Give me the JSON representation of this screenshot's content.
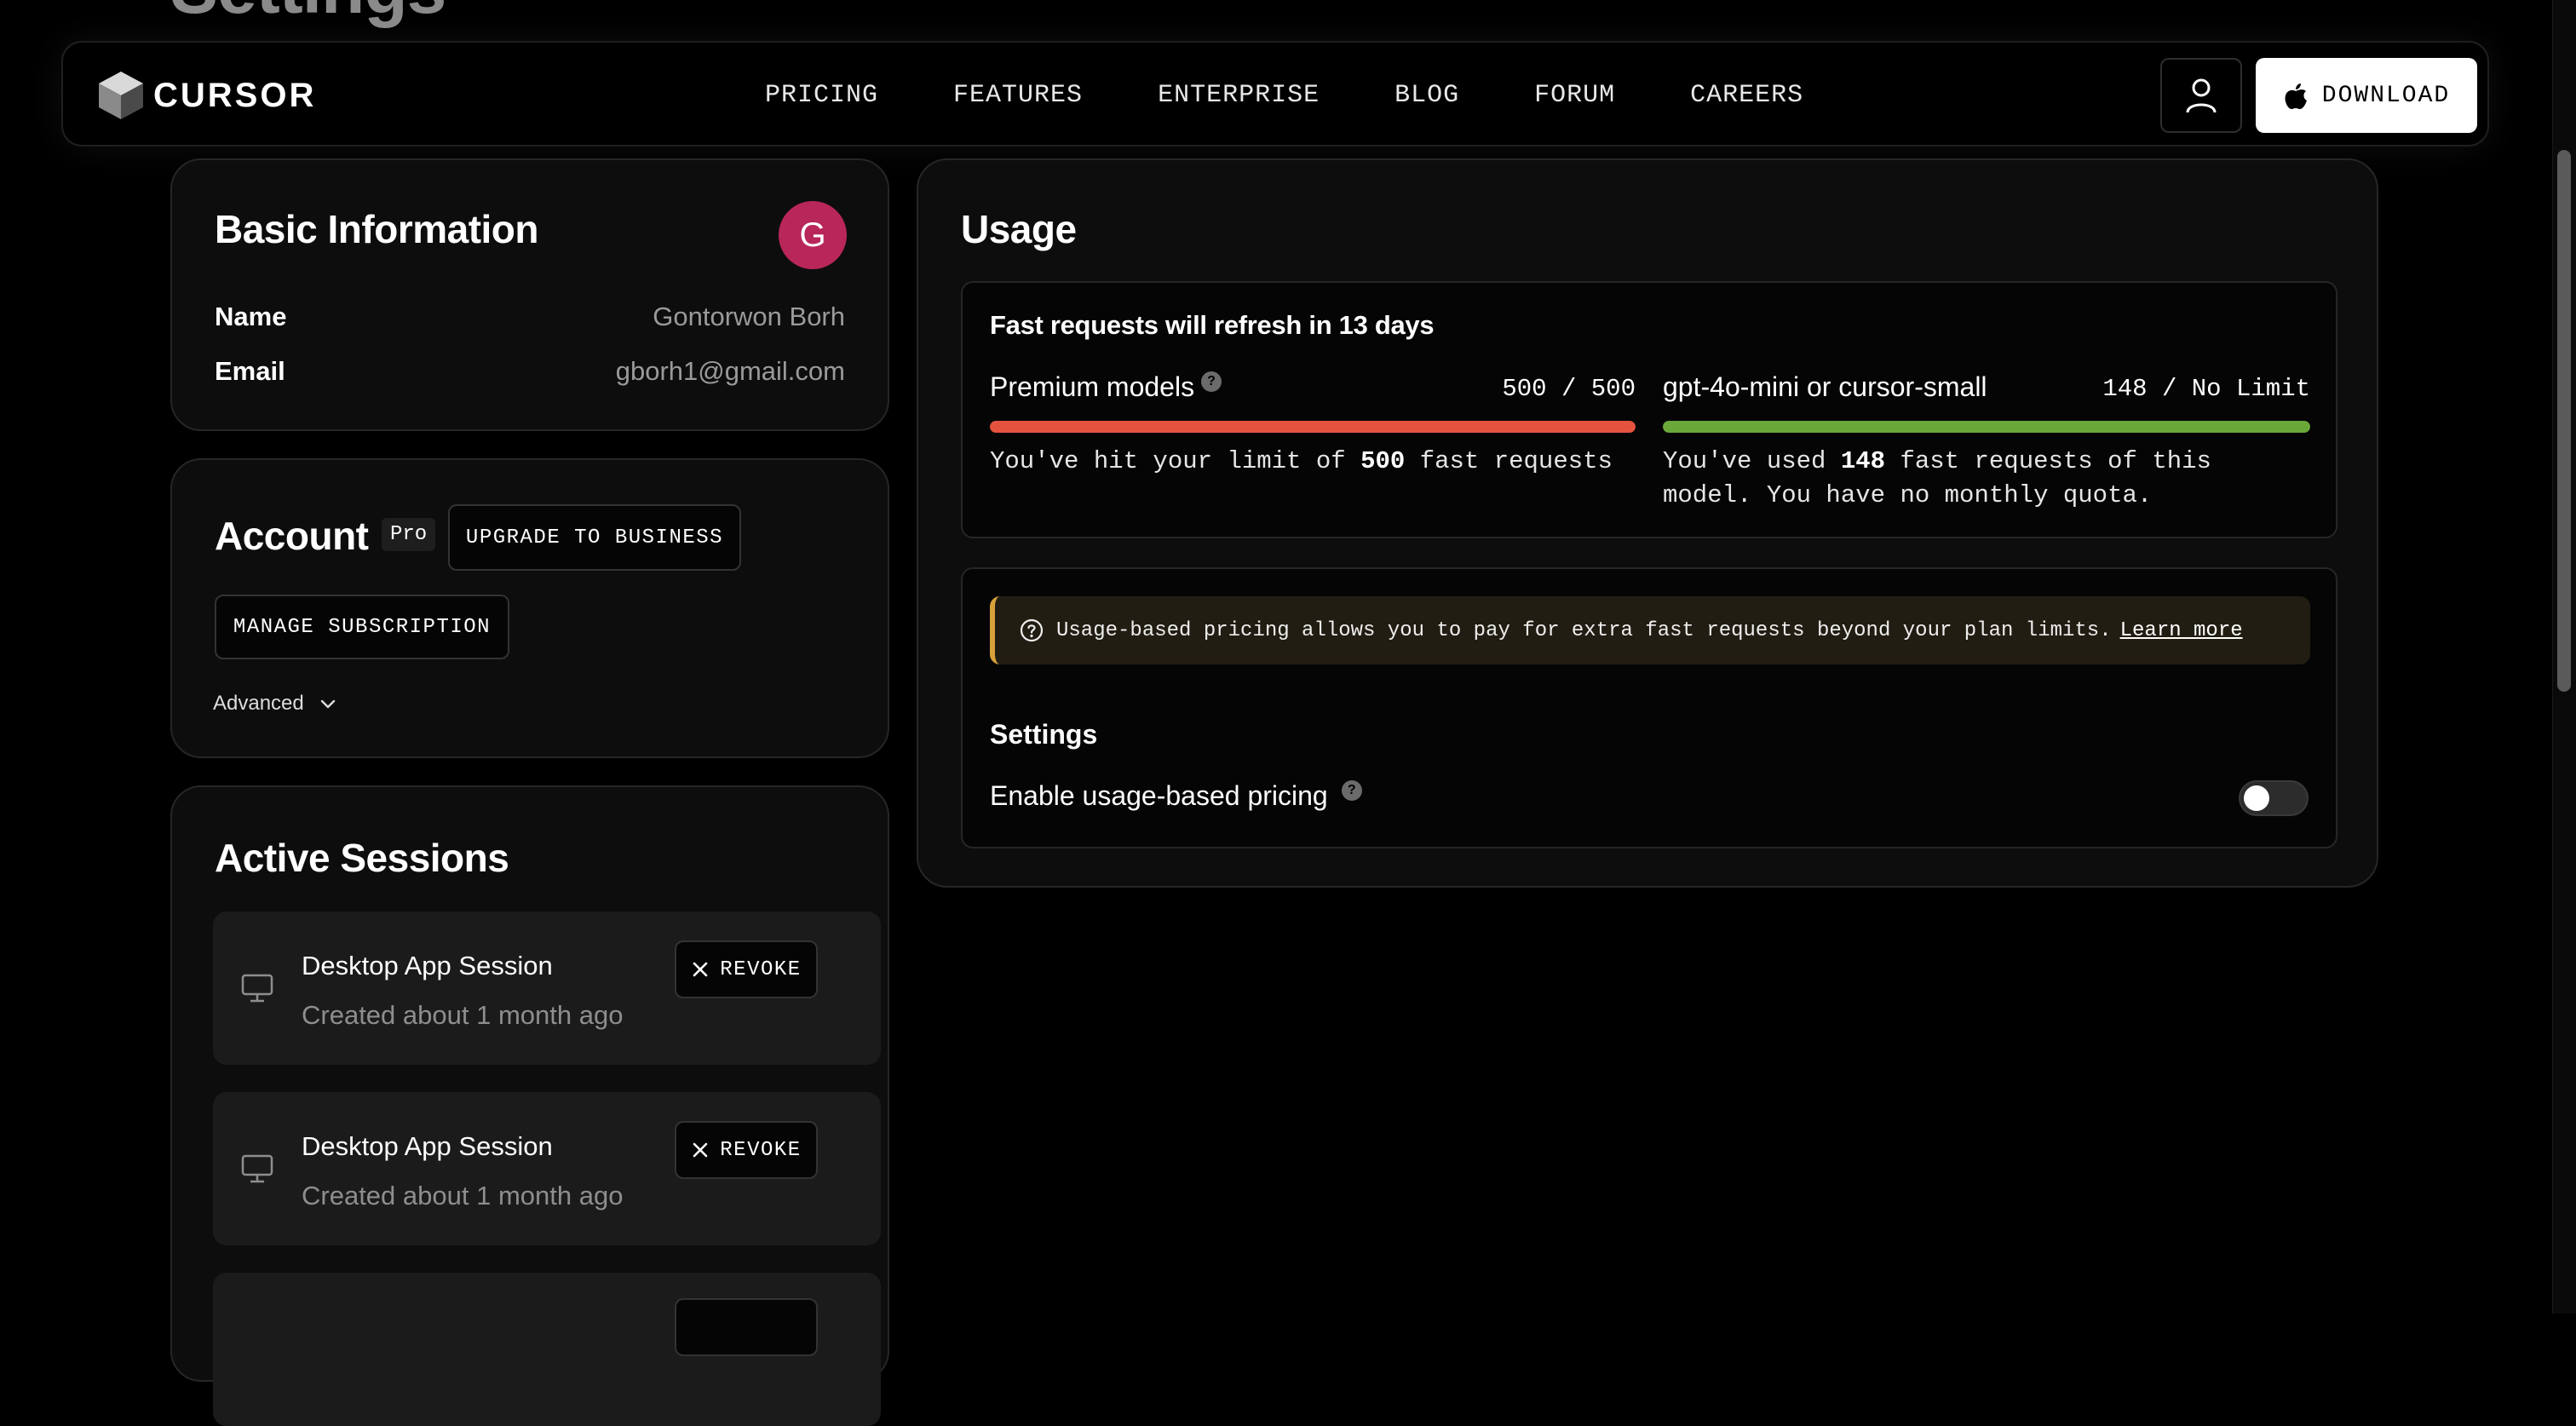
{
  "page": {
    "title": "Settings"
  },
  "nav": {
    "logo_text": "CURSOR",
    "links": [
      "PRICING",
      "FEATURES",
      "ENTERPRISE",
      "BLOG",
      "FORUM",
      "CAREERS"
    ],
    "download_label": "DOWNLOAD"
  },
  "basic": {
    "title": "Basic Information",
    "avatar_initial": "G",
    "avatar_color": "#b8265a",
    "name_label": "Name",
    "name_value": "Gontorwon Borh",
    "email_label": "Email",
    "email_value": "gborh1@gmail.com"
  },
  "account": {
    "title": "Account",
    "plan_badge": "Pro",
    "upgrade_label": "UPGRADE TO BUSINESS",
    "manage_label": "MANAGE SUBSCRIPTION",
    "advanced_label": "Advanced"
  },
  "sessions": {
    "title": "Active Sessions",
    "items": [
      {
        "title": "Desktop App Session",
        "subtitle": "Created about 1 month ago",
        "revoke_label": "REVOKE"
      },
      {
        "title": "Desktop App Session",
        "subtitle": "Created about 1 month ago",
        "revoke_label": "REVOKE"
      }
    ]
  },
  "usage": {
    "title": "Usage",
    "refresh_text": "Fast requests will refresh in 13 days",
    "premium": {
      "label": "Premium models",
      "count": "500 / 500",
      "fill_fraction": 1.0,
      "color": "#e5533f",
      "desc_prefix": "You've hit your limit of ",
      "desc_bold": "500",
      "desc_suffix": " fast requests"
    },
    "small": {
      "label": "gpt-4o-mini or cursor-small",
      "count": "148 / No Limit",
      "fill_fraction": 1.0,
      "color": "#6aa83a",
      "desc_prefix": "You've used ",
      "desc_bold": "148",
      "desc_suffix": " fast requests of this model. You have no monthly quota."
    },
    "notice_text": "Usage-based pricing allows you to pay for extra fast requests beyond your plan limits.",
    "notice_link": "Learn more",
    "settings_heading": "Settings",
    "toggle_label": "Enable usage-based pricing",
    "toggle_on": false
  }
}
